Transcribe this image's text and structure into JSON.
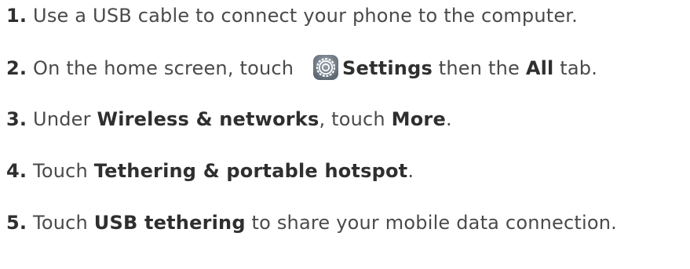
{
  "steps": [
    {
      "number": "1.",
      "text_a": " Use a USB cable to connect your phone to the computer."
    },
    {
      "number": "2.",
      "text_a": " On the home screen, touch ",
      "icon": "settings-gear-icon",
      "bold_a": "Settings",
      "text_b": " then the ",
      "bold_b": "All",
      "text_c": " tab."
    },
    {
      "number": "3.",
      "text_a": " Under ",
      "bold_a": "Wireless & networks",
      "text_b": ", touch ",
      "bold_b": "More",
      "text_c": "."
    },
    {
      "number": "4.",
      "text_a": " Touch ",
      "bold_a": "Tethering & portable hotspot",
      "text_b": "."
    },
    {
      "number": "5.",
      "text_a": " Touch ",
      "bold_a": "USB tethering",
      "text_b": " to share your mobile data connection."
    }
  ],
  "colors": {
    "text": "#4a4a4a",
    "bold": "#2f2f2f",
    "icon_bg": "#6e7a86"
  }
}
